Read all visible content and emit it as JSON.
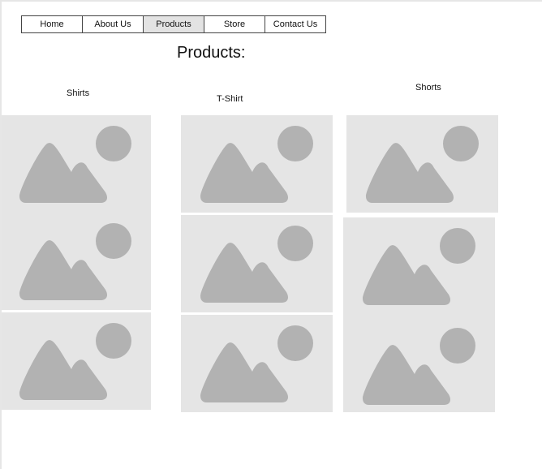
{
  "nav": {
    "items": [
      {
        "label": "Home"
      },
      {
        "label": "About Us"
      },
      {
        "label": "Products",
        "active": true
      },
      {
        "label": "Store"
      },
      {
        "label": "Contact Us"
      }
    ]
  },
  "page": {
    "title": "Products:"
  },
  "columns": [
    {
      "label": "Shirts",
      "image_count": 3
    },
    {
      "label": "T-Shirt",
      "image_count": 3
    },
    {
      "label": "Shorts",
      "image_count": 2
    }
  ],
  "colors": {
    "placeholder_bg": "#e5e5e5",
    "placeholder_shape": "#b2b2b2",
    "active_tab": "#e3e3e3"
  },
  "icons": {
    "image_placeholder": "image-placeholder-icon"
  }
}
